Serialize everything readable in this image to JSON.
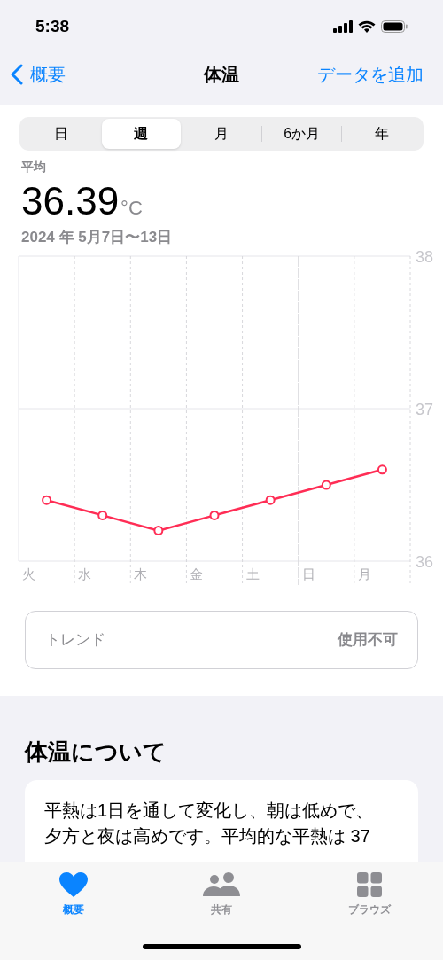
{
  "status_bar": {
    "time": "5:38"
  },
  "nav": {
    "back": "概要",
    "title": "体温",
    "action": "データを追加"
  },
  "segments": [
    {
      "label": "日",
      "selected": false
    },
    {
      "label": "週",
      "selected": true
    },
    {
      "label": "月",
      "selected": false
    },
    {
      "label": "6か月",
      "selected": false
    },
    {
      "label": "年",
      "selected": false
    }
  ],
  "summary": {
    "label": "平均",
    "value": "36.39",
    "unit": "°C",
    "range": "2024 年 5月7日〜13日"
  },
  "chart_data": {
    "type": "line",
    "categories": [
      "火",
      "水",
      "木",
      "金",
      "土",
      "日",
      "月"
    ],
    "series": [
      {
        "color": "#ff2d55",
        "marker": "circle",
        "values": [
          36.4,
          36.3,
          36.2,
          36.3,
          36.4,
          36.5,
          36.6
        ]
      }
    ],
    "ylim": [
      36,
      38
    ],
    "yticks": [
      36,
      37,
      38
    ]
  },
  "trend": {
    "label": "トレンド",
    "value": "使用不可"
  },
  "about": {
    "title": "体温について",
    "text": "平熱は1日を通して変化し、朝は低めで、夕方と夜は高めです。平均的な平熱は 37"
  },
  "tab_bar": [
    {
      "label": "概要",
      "selected": true
    },
    {
      "label": "共有",
      "selected": false
    },
    {
      "label": "ブラウズ",
      "selected": false
    }
  ]
}
